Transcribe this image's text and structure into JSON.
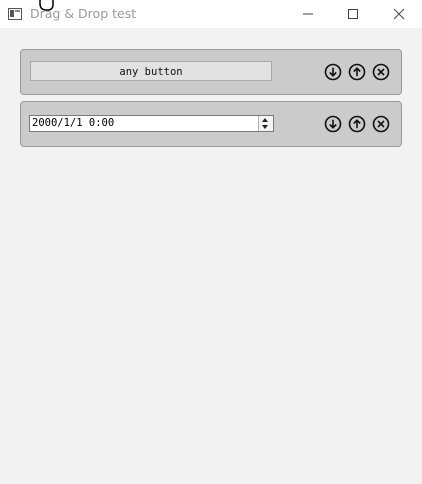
{
  "window": {
    "title": "Drag & Drop test",
    "icons": [
      "app-icon",
      "hand-cursor-icon",
      "minimize-icon",
      "maximize-icon",
      "close-icon"
    ]
  },
  "rows": [
    {
      "widget": "button",
      "label": "any button",
      "actions": [
        "move-down-icon",
        "move-up-icon",
        "remove-icon"
      ]
    },
    {
      "widget": "datetime",
      "value": "2000/1/1 0:00",
      "actions": [
        "move-down-icon",
        "move-up-icon",
        "remove-icon"
      ]
    }
  ],
  "colors": {
    "background": "#f2f2f2",
    "row_background": "#cbcbcb",
    "title_text": "#9a9a9a"
  }
}
